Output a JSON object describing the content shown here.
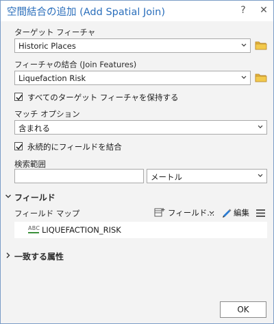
{
  "window": {
    "title": "空間結合の追加 (Add Spatial Join)",
    "help_glyph": "?",
    "close_glyph": "✕"
  },
  "target_features": {
    "label": "ターゲット フィーチャ",
    "value": "Historic Places",
    "browse_icon": "folder-icon"
  },
  "join_features": {
    "label": "フィーチャの結合 (Join Features)",
    "value": "Liquefaction Risk",
    "browse_icon": "folder-icon"
  },
  "keep_all_targets": {
    "label": "すべてのターゲット フィーチャを保持する",
    "checked": true
  },
  "match_option": {
    "label": "マッチ オプション",
    "value": "含まれる"
  },
  "permanent_join": {
    "label": "永続的にフィールドを結合",
    "checked": true
  },
  "search_radius": {
    "label": "検索範囲",
    "value": "",
    "unit": "メートル"
  },
  "fields_section": {
    "title": "フィールド",
    "expanded": true,
    "field_map_label": "フィールド マップ",
    "field_button_label": "フィールド...",
    "edit_label": "編集",
    "items": [
      {
        "type_badge": "ABC",
        "name": "LIQUEFACTION_RISK"
      }
    ]
  },
  "matching_attributes_section": {
    "title": "一致する属性",
    "expanded": false
  },
  "ok_button": {
    "label": "OK"
  },
  "colors": {
    "title_blue": "#2a6ebb",
    "folder_yellow": "#e2b33c",
    "checkmark": "#1b1b1b",
    "abc_green": "#3a8f3a",
    "pencil_blue": "#2b7cd3"
  }
}
